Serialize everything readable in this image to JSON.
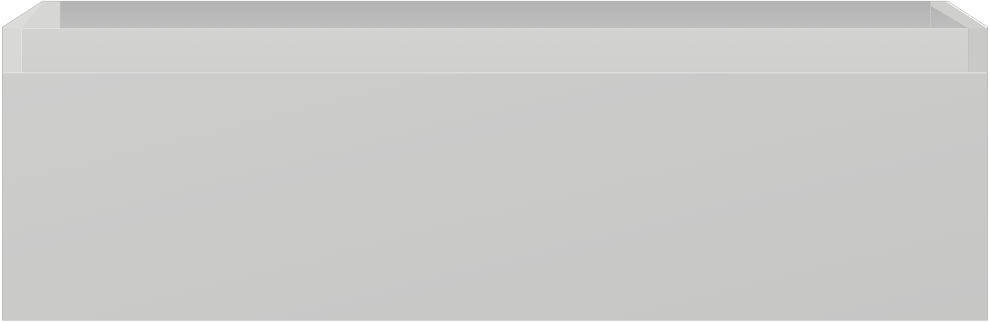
{
  "product": {
    "name": "",
    "colors": {
      "background": "#ffffff",
      "front_panel": "#cbcbca",
      "front_panel_shade": "#c6c6c5",
      "back_inner_wall": "#b9b9b9",
      "side_wall_top": "#d2d2d1",
      "left_wall_face": "#d5d5d4",
      "right_wall_face": "#bdbdbc",
      "inner_rim": "#d9d9d8",
      "edge_line": "#e7e7e6",
      "outline": "#bdbdbc"
    }
  }
}
